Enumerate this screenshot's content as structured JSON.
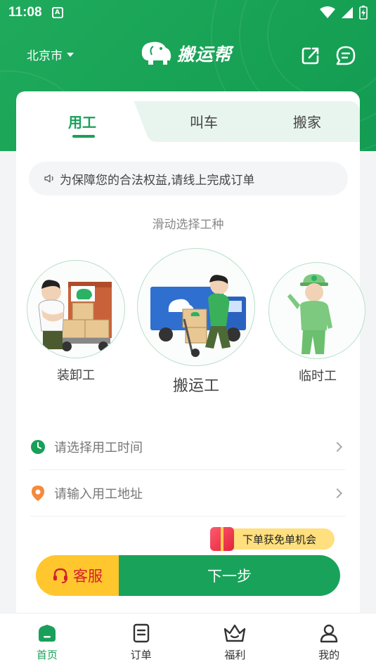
{
  "status_bar": {
    "time": "11:08",
    "notif_letter": "A"
  },
  "header": {
    "city": "北京市",
    "brand": "搬运帮"
  },
  "tabs": [
    {
      "label": "用工",
      "active": true
    },
    {
      "label": "叫车",
      "active": false
    },
    {
      "label": "搬家",
      "active": false
    }
  ],
  "notice": {
    "text": "为保障您的合法权益,请线上完成订单"
  },
  "slide_hint": "滑动选择工种",
  "workers": [
    {
      "label": "装卸工",
      "selected": false
    },
    {
      "label": "搬运工",
      "selected": true
    },
    {
      "label": "临时工",
      "selected": false
    }
  ],
  "form": {
    "time_placeholder": "请选择用工时间",
    "address_placeholder": "请输入用工地址"
  },
  "promo": {
    "text": "下单获免单机会"
  },
  "cta": {
    "service_label": "客服",
    "next_label": "下一步"
  },
  "bottom_nav": [
    {
      "label": "首页",
      "icon": "home-icon",
      "active": true
    },
    {
      "label": "订单",
      "icon": "order-icon",
      "active": false
    },
    {
      "label": "福利",
      "icon": "crown-icon",
      "active": false
    },
    {
      "label": "我的",
      "icon": "user-icon",
      "active": false
    }
  ],
  "colors": {
    "brand_green": "#18a05a",
    "accent_yellow": "#ffc62d",
    "service_red": "#d3202e"
  }
}
